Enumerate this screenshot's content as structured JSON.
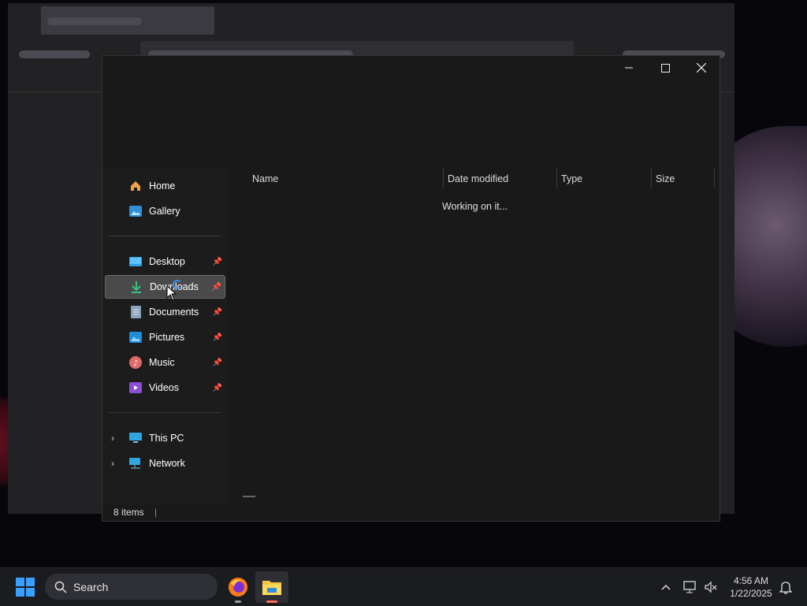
{
  "nav": {
    "pinned": [
      {
        "label": "Home",
        "icon": "home-icon"
      },
      {
        "label": "Gallery",
        "icon": "gallery-icon"
      }
    ],
    "quick_access": [
      {
        "label": "Desktop",
        "icon": "desktop-icon",
        "pinned": true
      },
      {
        "label": "Downloads",
        "icon": "download-icon",
        "pinned": true,
        "selected": true
      },
      {
        "label": "Documents",
        "icon": "documents-icon",
        "pinned": true
      },
      {
        "label": "Pictures",
        "icon": "pictures-icon",
        "pinned": true
      },
      {
        "label": "Music",
        "icon": "music-icon",
        "pinned": true
      },
      {
        "label": "Videos",
        "icon": "videos-icon",
        "pinned": true
      }
    ],
    "devices": [
      {
        "label": "This PC",
        "icon": "pc-icon"
      },
      {
        "label": "Network",
        "icon": "network-icon"
      }
    ]
  },
  "columns": [
    "Name",
    "Date modified",
    "Type",
    "Size"
  ],
  "loading_text": "Working on it...",
  "status": {
    "item_count": "8 items"
  },
  "taskbar": {
    "search_label": "Search",
    "time": "4:56 AM",
    "date": "1/22/2025"
  },
  "colors": {
    "accent": "#0078d4",
    "selection": "#4a4a4a"
  }
}
